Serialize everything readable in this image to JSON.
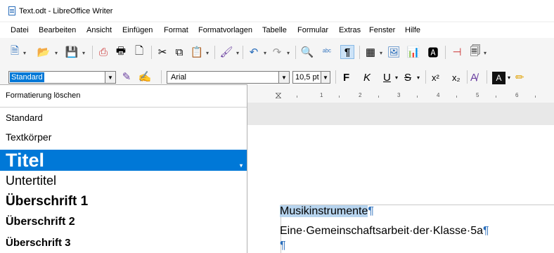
{
  "window": {
    "title": "Text.odt - LibreOffice Writer",
    "icon": "writer-doc-icon"
  },
  "menu": [
    {
      "label": "Datei"
    },
    {
      "label": "Bearbeiten"
    },
    {
      "label": "Ansicht"
    },
    {
      "label": "Einfügen"
    },
    {
      "label": "Format"
    },
    {
      "label": "Formatvorlagen"
    },
    {
      "label": "Tabelle"
    },
    {
      "label": "Formular"
    },
    {
      "label": "Extras"
    },
    {
      "label": "Fenster"
    },
    {
      "label": "Hilfe"
    }
  ],
  "toolbar_icons": [
    "new-doc-icon",
    "open-folder-icon",
    "save-icon",
    "export-pdf-icon",
    "print-icon",
    "print-preview-icon",
    "cut-icon",
    "copy-icon",
    "paste-icon",
    "clone-format-icon",
    "undo-icon",
    "redo-icon",
    "find-replace-icon",
    "spellcheck-icon",
    "formatting-marks-icon",
    "table-icon",
    "image-icon",
    "chart-icon",
    "textbox-icon",
    "page-break-icon",
    "field-icon"
  ],
  "style_box": {
    "value": "Standard"
  },
  "font_box": {
    "value": "Arial"
  },
  "size_box": {
    "value": "10,5 pt"
  },
  "format_buttons": {
    "bold": "F",
    "italic": "K",
    "underline": "U",
    "strike": "S",
    "super": "x²",
    "sub": "x₂"
  },
  "accent": "#0078d7",
  "ruler": {
    "numbers": [
      "1",
      "2",
      "3",
      "4",
      "5",
      "6"
    ]
  },
  "dropdown": {
    "clear": "Formatierung löschen",
    "items": [
      {
        "label": "Standard"
      },
      {
        "label": "Textkörper"
      },
      {
        "label": "Titel"
      },
      {
        "label": "Untertitel"
      },
      {
        "label": "Überschrift 1"
      },
      {
        "label": "Überschrift 2"
      },
      {
        "label": "Überschrift 3"
      }
    ]
  },
  "document": {
    "line1": "Musikinstrumente",
    "line2": "Eine·Gemeinschaftsarbeit·der·Klasse·5a",
    "pilcrow": "¶"
  }
}
